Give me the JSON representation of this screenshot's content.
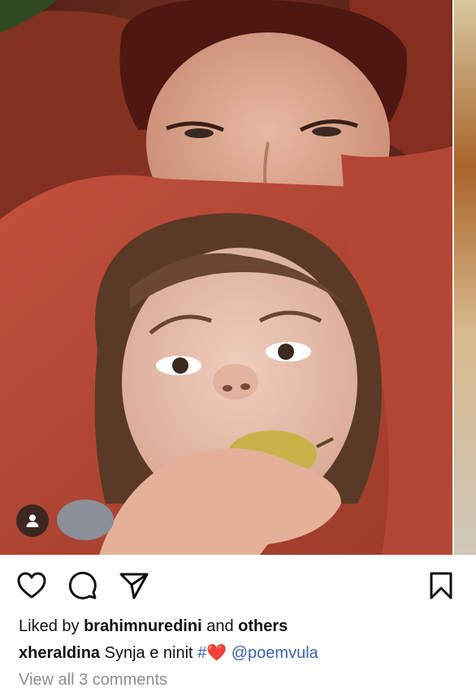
{
  "post": {
    "photo_alt": "",
    "actions": {
      "like_icon": "heart-outline-icon",
      "comment_icon": "speech-bubble-icon",
      "share_icon": "paper-plane-icon",
      "save_icon": "bookmark-icon"
    },
    "likes": {
      "prefix": "Liked by",
      "user": "brahimnuredini",
      "conjunction": "and",
      "others": "others"
    },
    "caption": {
      "username": "xheraldina",
      "text": "Synja e ninit",
      "hash": "#",
      "emoji": "❤️",
      "mention": "@poemvula"
    },
    "view_comments": "View all 3 comments"
  },
  "colors": {
    "link": "#3a63b8",
    "text": "#111111",
    "muted": "#8e8e8e"
  }
}
